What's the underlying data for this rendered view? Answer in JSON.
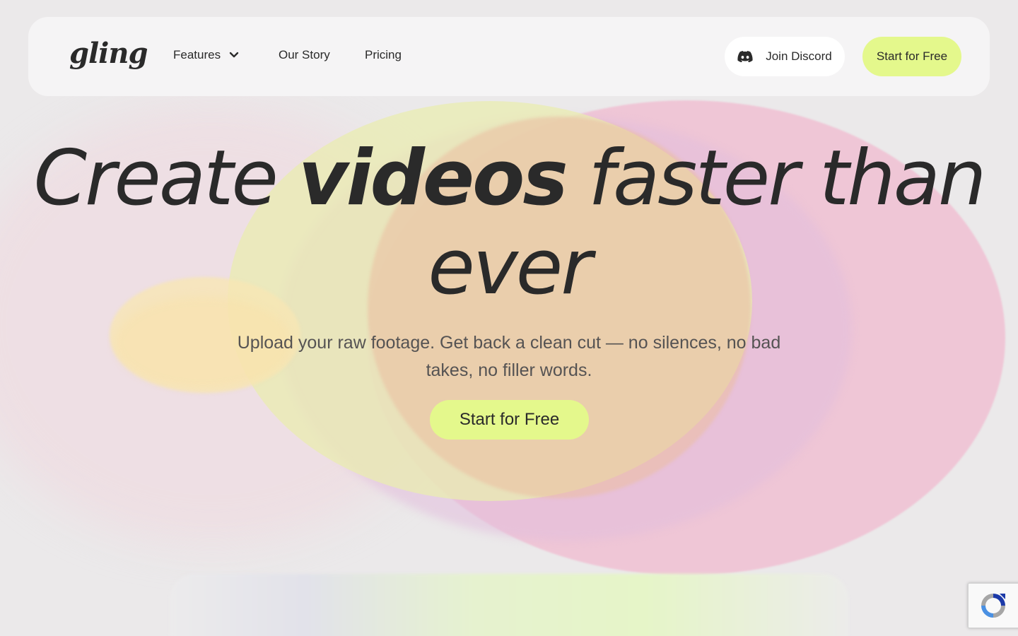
{
  "brand": {
    "logo_text": "gling",
    "accent_color": "#e4f88c"
  },
  "nav": {
    "items": [
      {
        "label": "Features",
        "icon": "chevron-down-icon"
      },
      {
        "label": "Our Story"
      },
      {
        "label": "Pricing"
      }
    ],
    "discord_label": "Join Discord",
    "discord_icon": "discord-icon",
    "cta_label": "Start for Free"
  },
  "hero": {
    "title_part1": "Create ",
    "title_bold": "videos",
    "title_part2": " faster than ever",
    "subtitle": "Upload your raw footage. Get back a clean cut — no silences, no bad takes, no filler words.",
    "cta_label": "Start for Free"
  },
  "recaptcha": {
    "icon": "recaptcha-icon"
  }
}
